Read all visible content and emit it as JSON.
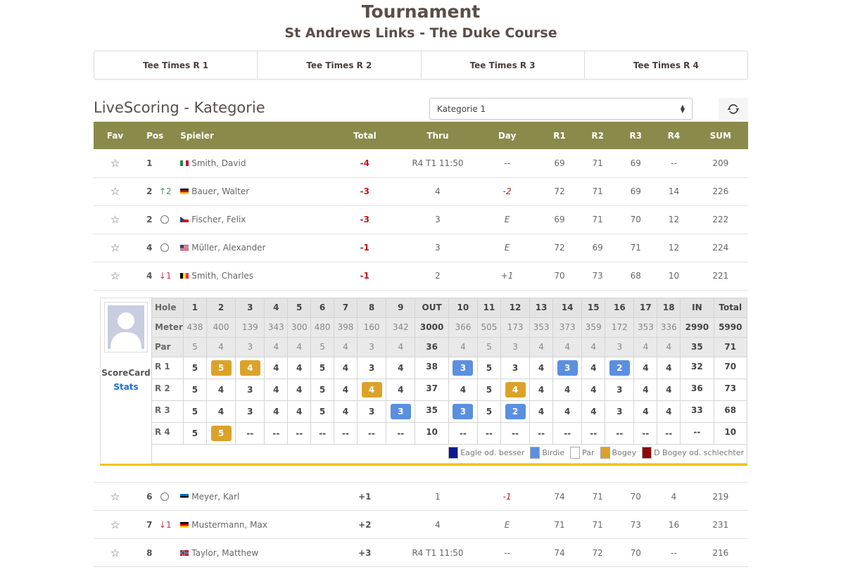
{
  "header": {
    "title": "Tournament",
    "subtitle": "St Andrews Links - The Duke Course"
  },
  "tee_tabs": [
    {
      "label": "Tee Times R 1"
    },
    {
      "label": "Tee Times R 2"
    },
    {
      "label": "Tee Times R 3"
    },
    {
      "label": "Tee Times R 4"
    }
  ],
  "livescoring": {
    "title": "LiveScoring - Kategorie",
    "category_selected": "Kategorie 1",
    "refresh_icon": "refresh-icon"
  },
  "leaderboard": {
    "columns": [
      "Fav",
      "Pos",
      "Spieler",
      "Total",
      "Thru",
      "Day",
      "R1",
      "R2",
      "R3",
      "R4",
      "SUM"
    ],
    "rows": [
      {
        "pos": "1",
        "move": "",
        "move_type": "none",
        "flag": "it",
        "name": "Smith, David",
        "total": "-4",
        "total_color": "red",
        "thru": "R4 T1 11:50",
        "day": "--",
        "day_style": "plain",
        "r1": "69",
        "r2": "71",
        "r3": "69",
        "r4": "--",
        "sum": "209"
      },
      {
        "pos": "2",
        "move": "↑2",
        "move_type": "up",
        "flag": "de",
        "name": "Bauer, Walter",
        "total": "-3",
        "total_color": "red",
        "thru": "4",
        "day": "-2",
        "day_style": "red",
        "r1": "72",
        "r2": "71",
        "r3": "69",
        "r4": "14",
        "sum": "226"
      },
      {
        "pos": "2",
        "move": "",
        "move_type": "same",
        "flag": "cz",
        "name": "Fischer, Felix",
        "total": "-3",
        "total_color": "red",
        "thru": "3",
        "day": "E",
        "day_style": "italic",
        "r1": "69",
        "r2": "71",
        "r3": "70",
        "r4": "12",
        "sum": "222"
      },
      {
        "pos": "4",
        "move": "",
        "move_type": "same",
        "flag": "us",
        "name": "Müller, Alexander",
        "total": "-1",
        "total_color": "red",
        "thru": "3",
        "day": "E",
        "day_style": "italic",
        "r1": "72",
        "r2": "69",
        "r3": "71",
        "r4": "12",
        "sum": "224"
      },
      {
        "pos": "4",
        "move": "↓1",
        "move_type": "down",
        "flag": "be",
        "name": "Smith, Charles",
        "total": "-1",
        "total_color": "red",
        "thru": "2",
        "day": "+1",
        "day_style": "italic",
        "r1": "70",
        "r2": "73",
        "r3": "68",
        "r4": "10",
        "sum": "221"
      }
    ],
    "rows_after": [
      {
        "pos": "6",
        "move": "",
        "move_type": "same",
        "flag": "ee",
        "name": "Meyer, Karl",
        "total": "+1",
        "total_color": "dark",
        "thru": "1",
        "day": "-1",
        "day_style": "red",
        "r1": "74",
        "r2": "71",
        "r3": "70",
        "r4": "4",
        "sum": "219"
      },
      {
        "pos": "7",
        "move": "↓1",
        "move_type": "down",
        "flag": "de",
        "name": "Mustermann, Max",
        "total": "+2",
        "total_color": "dark",
        "thru": "4",
        "day": "E",
        "day_style": "italic",
        "r1": "71",
        "r2": "71",
        "r3": "73",
        "r4": "16",
        "sum": "231"
      },
      {
        "pos": "8",
        "move": "",
        "move_type": "none",
        "flag": "no",
        "name": "Taylor, Matthew",
        "total": "+3",
        "total_color": "dark",
        "thru": "R4 T1 11:50",
        "day": "--",
        "day_style": "plain",
        "r1": "74",
        "r2": "72",
        "r3": "70",
        "r4": "--",
        "sum": "216"
      }
    ]
  },
  "scorecard": {
    "label": "ScoreCard",
    "stats_link": "Stats",
    "header": [
      "Hole",
      "1",
      "2",
      "3",
      "4",
      "5",
      "6",
      "7",
      "8",
      "9",
      "OUT",
      "10",
      "11",
      "12",
      "13",
      "14",
      "15",
      "16",
      "17",
      "18",
      "IN",
      "Total"
    ],
    "meter": [
      "Meter",
      "438",
      "400",
      "139",
      "343",
      "300",
      "480",
      "398",
      "160",
      "342",
      "3000",
      "366",
      "505",
      "173",
      "353",
      "373",
      "359",
      "172",
      "353",
      "336",
      "2990",
      "5990"
    ],
    "par": [
      "Par",
      "5",
      "4",
      "3",
      "4",
      "4",
      "5",
      "4",
      "3",
      "4",
      "36",
      "4",
      "5",
      "3",
      "4",
      "4",
      "4",
      "3",
      "4",
      "4",
      "35",
      "71"
    ],
    "rounds": [
      {
        "label": "R 1",
        "scores": [
          {
            "v": "5",
            "t": ""
          },
          {
            "v": "5",
            "t": "bogey"
          },
          {
            "v": "4",
            "t": "bogey"
          },
          {
            "v": "4",
            "t": ""
          },
          {
            "v": "4",
            "t": ""
          },
          {
            "v": "5",
            "t": ""
          },
          {
            "v": "4",
            "t": ""
          },
          {
            "v": "3",
            "t": ""
          },
          {
            "v": "4",
            "t": ""
          },
          {
            "v": "38",
            "t": "sum"
          },
          {
            "v": "3",
            "t": "birdie"
          },
          {
            "v": "5",
            "t": ""
          },
          {
            "v": "3",
            "t": ""
          },
          {
            "v": "4",
            "t": ""
          },
          {
            "v": "3",
            "t": "birdie"
          },
          {
            "v": "4",
            "t": ""
          },
          {
            "v": "2",
            "t": "birdie"
          },
          {
            "v": "4",
            "t": ""
          },
          {
            "v": "4",
            "t": ""
          },
          {
            "v": "32",
            "t": "sum"
          },
          {
            "v": "70",
            "t": "sum"
          }
        ]
      },
      {
        "label": "R 2",
        "scores": [
          {
            "v": "5",
            "t": ""
          },
          {
            "v": "4",
            "t": ""
          },
          {
            "v": "3",
            "t": ""
          },
          {
            "v": "4",
            "t": ""
          },
          {
            "v": "4",
            "t": ""
          },
          {
            "v": "5",
            "t": ""
          },
          {
            "v": "4",
            "t": ""
          },
          {
            "v": "4",
            "t": "bogey"
          },
          {
            "v": "4",
            "t": ""
          },
          {
            "v": "37",
            "t": "sum"
          },
          {
            "v": "4",
            "t": ""
          },
          {
            "v": "5",
            "t": ""
          },
          {
            "v": "4",
            "t": "bogey"
          },
          {
            "v": "4",
            "t": ""
          },
          {
            "v": "4",
            "t": ""
          },
          {
            "v": "4",
            "t": ""
          },
          {
            "v": "3",
            "t": ""
          },
          {
            "v": "4",
            "t": ""
          },
          {
            "v": "4",
            "t": ""
          },
          {
            "v": "36",
            "t": "sum"
          },
          {
            "v": "73",
            "t": "sum"
          }
        ]
      },
      {
        "label": "R 3",
        "scores": [
          {
            "v": "5",
            "t": ""
          },
          {
            "v": "4",
            "t": ""
          },
          {
            "v": "3",
            "t": ""
          },
          {
            "v": "4",
            "t": ""
          },
          {
            "v": "4",
            "t": ""
          },
          {
            "v": "5",
            "t": ""
          },
          {
            "v": "4",
            "t": ""
          },
          {
            "v": "3",
            "t": ""
          },
          {
            "v": "3",
            "t": "birdie"
          },
          {
            "v": "35",
            "t": "sum"
          },
          {
            "v": "3",
            "t": "birdie"
          },
          {
            "v": "5",
            "t": ""
          },
          {
            "v": "2",
            "t": "birdie"
          },
          {
            "v": "4",
            "t": ""
          },
          {
            "v": "4",
            "t": ""
          },
          {
            "v": "4",
            "t": ""
          },
          {
            "v": "3",
            "t": ""
          },
          {
            "v": "4",
            "t": ""
          },
          {
            "v": "4",
            "t": ""
          },
          {
            "v": "33",
            "t": "sum"
          },
          {
            "v": "68",
            "t": "sum"
          }
        ]
      },
      {
        "label": "R 4",
        "scores": [
          {
            "v": "5",
            "t": ""
          },
          {
            "v": "5",
            "t": "bogey"
          },
          {
            "v": "--",
            "t": ""
          },
          {
            "v": "--",
            "t": ""
          },
          {
            "v": "--",
            "t": ""
          },
          {
            "v": "--",
            "t": ""
          },
          {
            "v": "--",
            "t": ""
          },
          {
            "v": "--",
            "t": ""
          },
          {
            "v": "--",
            "t": ""
          },
          {
            "v": "10",
            "t": "sum"
          },
          {
            "v": "--",
            "t": ""
          },
          {
            "v": "--",
            "t": ""
          },
          {
            "v": "--",
            "t": ""
          },
          {
            "v": "--",
            "t": ""
          },
          {
            "v": "--",
            "t": ""
          },
          {
            "v": "--",
            "t": ""
          },
          {
            "v": "--",
            "t": ""
          },
          {
            "v": "--",
            "t": ""
          },
          {
            "v": "--",
            "t": ""
          },
          {
            "v": "--",
            "t": "sum"
          },
          {
            "v": "10",
            "t": "sum"
          }
        ]
      }
    ],
    "legend": [
      {
        "label": "Eagle od. besser",
        "color": "#0a1a8c"
      },
      {
        "label": "Birdie",
        "color": "#5b8fe0"
      },
      {
        "label": "Par",
        "color": "#ffffff"
      },
      {
        "label": "Bogey",
        "color": "#dba22a"
      },
      {
        "label": "D Bogey od. schlechter",
        "color": "#8b0a0a"
      }
    ]
  },
  "colors": {
    "header_bar": "#8a8a4b",
    "accent_underline": "#f0c419",
    "score_red": "#c0141e",
    "link_blue": "#1a6fd1"
  }
}
